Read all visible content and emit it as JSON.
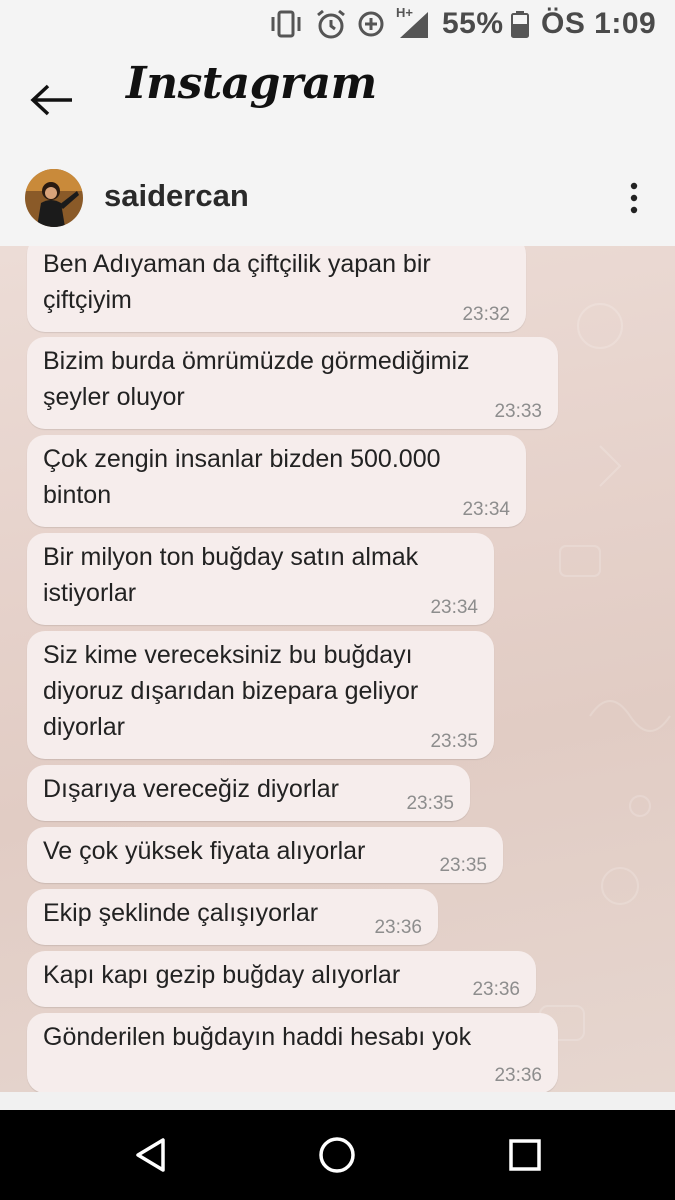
{
  "status_bar": {
    "battery_percent": "55%",
    "time": "ÖS 1:09",
    "network_label": "H+",
    "icons": [
      "vibrate-icon",
      "alarm-icon",
      "data-saver-icon",
      "signal-icon",
      "battery-icon"
    ]
  },
  "header": {
    "title": "Instagram",
    "back_icon": "back-arrow-icon"
  },
  "thread": {
    "username": "saidercan",
    "more_icon": "more-vertical-icon"
  },
  "messages": [
    {
      "text": "Ben Adıyaman da çiftçilik yapan bir\nçiftçiyim",
      "time": "23:32"
    },
    {
      "text": "Bizim burda ömrümüzde görmediğimiz\nşeyler oluyor",
      "time": "23:33"
    },
    {
      "text": "Çok zengin insanlar bizden 500.000\nbinton",
      "time": "23:34"
    },
    {
      "text": "Bir milyon ton buğday satın almak\nistiyorlar",
      "time": "23:34"
    },
    {
      "text": "Siz kime vereceksiniz bu buğdayı\ndiyoruz dışarıdan bizepara geliyor\ndiyorlar",
      "time": "23:35"
    },
    {
      "text": "Dışarıya vereceğiz diyorlar",
      "time": "23:35"
    },
    {
      "text": "Ve çok yüksek fiyata alıyorlar",
      "time": "23:35"
    },
    {
      "text": "Ekip şeklinde çalışıyorlar",
      "time": "23:36"
    },
    {
      "text": "Kapı kapı gezip buğday alıyorlar",
      "time": "23:36"
    },
    {
      "text": "Gönderilen buğdayın haddi hesabı yok",
      "time": "23:36"
    }
  ],
  "nav": {
    "icons": [
      "back-triangle-icon",
      "home-circle-icon",
      "recents-square-icon"
    ]
  },
  "colors": {
    "bubble": "#f6edec",
    "chat_background": "#e6d2cb",
    "timestamp": "#8d8d8d",
    "nav_bar": "#000000"
  }
}
